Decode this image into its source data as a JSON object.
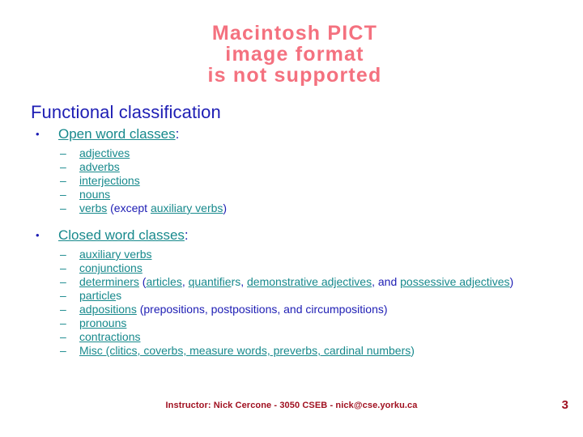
{
  "placeholder_image": {
    "text": "Macintosh PICT\nimage format\nis not supported",
    "color": "#f4717f"
  },
  "slide": {
    "title": "Functional classification",
    "title_color": "#1d1db4",
    "link_color": "#17898c",
    "bullet_glyph": "•",
    "dash_glyph": "–"
  },
  "sections": [
    {
      "heading": "Open word classes",
      "heading_colon": ":",
      "items": [
        {
          "link": "adjectives",
          "tail": "",
          "rest": ""
        },
        {
          "link": "adverbs",
          "tail": "",
          "rest": ""
        },
        {
          "link": "interjections",
          "tail": "",
          "rest": ""
        },
        {
          "link": "nouns",
          "tail": "",
          "rest": ""
        },
        {
          "link": "verbs",
          "tail": "",
          "rest": " (except ",
          "link2": "auxiliary verbs",
          "rest2": ")"
        }
      ]
    },
    {
      "heading": "Closed word classes",
      "heading_colon": ":",
      "items": [
        {
          "link": "auxiliary verbs"
        },
        {
          "link": "conjunctions"
        },
        {
          "link": "determiners"
        },
        {
          "link": "particles"
        },
        {
          "link": "adpositions"
        },
        {
          "link": "pronouns"
        },
        {
          "link": "contractions"
        },
        {
          "link": "Misc (clitics, coverbs, measure words, preverbs, cardinal numbers"
        }
      ]
    }
  ],
  "open_items": {
    "adjectives": "adjectives",
    "adverbs": "adverbs",
    "interjections": "interjections",
    "nouns": "nouns",
    "verbs_link": "verbs",
    "verbs_mid": " (except ",
    "verbs_link2": "auxiliary verbs",
    "verbs_end": ")"
  },
  "closed_items": {
    "auxiliary_verbs": "auxiliary verbs",
    "conjunctions": "conjunctions",
    "determiners_link": "determiners",
    "determiners_open": " (",
    "determiners_a": "articles",
    "determiners_sep1": ", ",
    "determiners_b": "quantifie",
    "determiners_b_tail": "rs",
    "determiners_sep2": ", ",
    "determiners_c": "demonstrative adjectives",
    "determiners_sep3": ", and ",
    "determiners_d": "possessive adjectives",
    "determiners_close": ")",
    "particles_link": "particle",
    "particles_tail": "s",
    "adpositions_link": "adpositions",
    "adpositions_rest": " (prepositions, postpositions, and circumpositions)",
    "pronouns": "pronouns",
    "contractions": "contractions",
    "misc_link": "Misc (clitics, coverbs, measure words, preverbs, cardinal numbers",
    "misc_close": ")"
  },
  "footer": {
    "instructor_line": "Instructor: Nick Cercone - 3050 CSEB - nick@cse.yorku.ca",
    "page_number": "3",
    "color": "#a01020"
  }
}
